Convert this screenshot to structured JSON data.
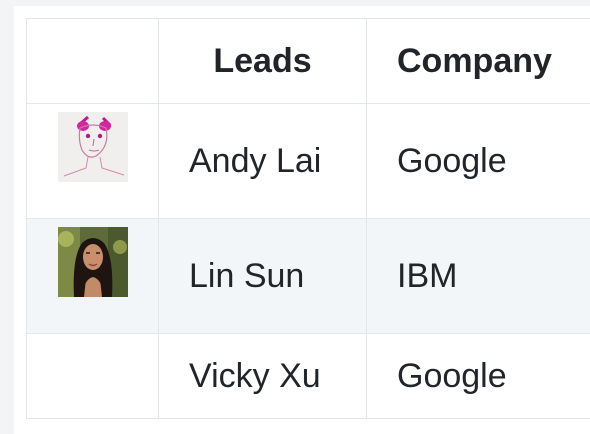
{
  "table": {
    "headers": {
      "avatar": "",
      "leads": "Leads",
      "company": "Company"
    },
    "rows": [
      {
        "name": "Andy Lai",
        "company": "Google",
        "avatar": "sketch-face-drawing"
      },
      {
        "name": "Lin Sun",
        "company": "IBM",
        "avatar": "woman-photo"
      },
      {
        "name": "Vicky Xu",
        "company": "Google",
        "avatar": ""
      }
    ]
  },
  "colors": {
    "border": "#e3e6ea",
    "stripe": "#f3f6f9",
    "text": "#212529",
    "page_bg": "#f3f4f6"
  }
}
